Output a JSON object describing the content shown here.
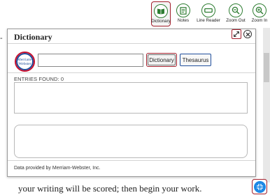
{
  "toolbar": {
    "items": [
      {
        "label": "Dictionary",
        "icon": "book-icon",
        "selected": true
      },
      {
        "label": "Notes",
        "icon": "notes-icon",
        "selected": false
      },
      {
        "label": "Line Reader",
        "icon": "line-reader-icon",
        "selected": false
      },
      {
        "label": "Zoom Out",
        "icon": "zoom-out-icon",
        "selected": false
      },
      {
        "label": "Zoom In",
        "icon": "zoom-in-icon",
        "selected": false
      }
    ]
  },
  "dialog": {
    "title": "Dictionary",
    "logo": {
      "line1": "Merriam-",
      "line2": "Webster"
    },
    "search": {
      "value": "",
      "placeholder": ""
    },
    "dictionary_button": "Dictionary",
    "thesaurus_button": "Thesaurus",
    "entries_found": "ENTRIES FOUND: 0",
    "provided_by": "Data provided by Merriam-Webster, Inc."
  },
  "page": {
    "visible_text": "your writing will be scored; then begin your work."
  },
  "colors": {
    "accent_red": "#a11d2a",
    "tool_green": "#2e7d32",
    "fab_blue": "#1e88e5"
  }
}
